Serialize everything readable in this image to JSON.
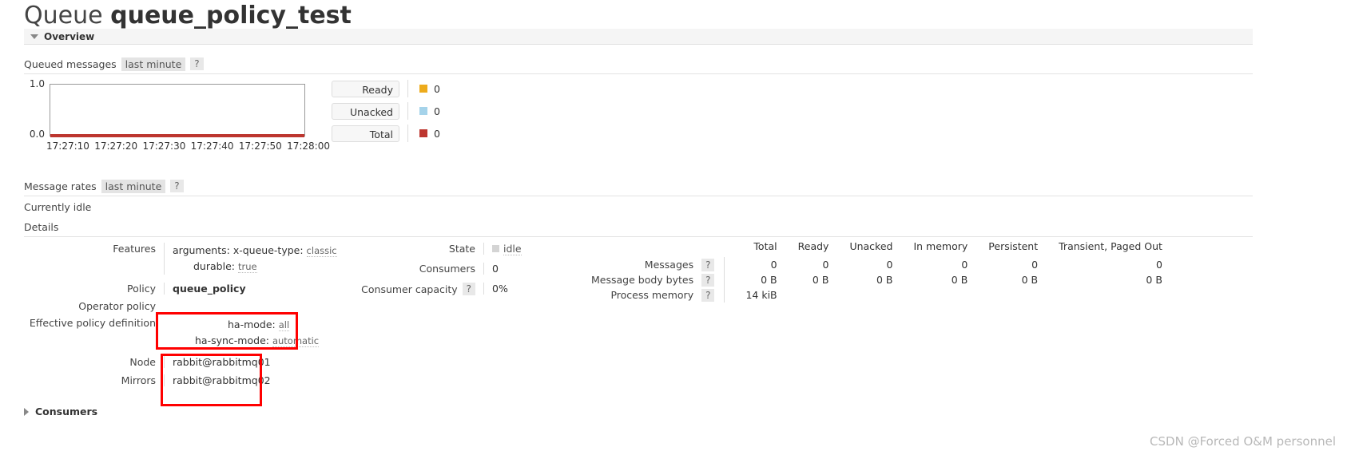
{
  "header": {
    "title_prefix": "Queue",
    "queue_name": "queue_policy_test",
    "overview_label": "Overview"
  },
  "queued_messages": {
    "label": "Queued messages",
    "period": "last minute",
    "help": "?"
  },
  "chart_data": {
    "type": "line",
    "title": "Queued messages last minute",
    "xlabel": "",
    "ylabel": "",
    "ylim": [
      0.0,
      1.0
    ],
    "ytick_labels": [
      "1.0",
      "0.0"
    ],
    "x": [
      "17:27:10",
      "17:27:20",
      "17:27:30",
      "17:27:40",
      "17:27:50",
      "17:28:00"
    ],
    "grid": false,
    "legend_position": "right",
    "series": [
      {
        "name": "Ready",
        "color": "#edab1c",
        "value": "0",
        "values": [
          0,
          0,
          0,
          0,
          0,
          0
        ]
      },
      {
        "name": "Unacked",
        "color": "#a5d3ea",
        "value": "0",
        "values": [
          0,
          0,
          0,
          0,
          0,
          0
        ]
      },
      {
        "name": "Total",
        "color": "#bd362f",
        "value": "0",
        "values": [
          0,
          0,
          0,
          0,
          0,
          0
        ]
      }
    ]
  },
  "message_rates": {
    "label": "Message rates",
    "period": "last minute",
    "help": "?",
    "status": "Currently idle"
  },
  "details": {
    "label": "Details",
    "features": {
      "label": "Features",
      "rows": [
        {
          "key": "arguments:",
          "sub_key": "x-queue-type:",
          "value": "classic"
        },
        {
          "key": "durable:",
          "sub_key": "",
          "value": "true"
        }
      ]
    },
    "policy": {
      "label": "Policy",
      "value": "queue_policy"
    },
    "operator_policy": {
      "label": "Operator policy",
      "value": ""
    },
    "effective_policy_definition": {
      "label": "Effective policy definition",
      "rows": [
        {
          "key": "ha-mode:",
          "value": "all"
        },
        {
          "key": "ha-sync-mode:",
          "value": "automatic"
        }
      ]
    },
    "node": {
      "label": "Node",
      "value": "rabbit@rabbitmq01"
    },
    "mirrors": {
      "label": "Mirrors",
      "value": "rabbit@rabbitmq02"
    },
    "state": {
      "label": "State",
      "value": "idle"
    },
    "consumers": {
      "label": "Consumers",
      "value": "0"
    },
    "consumer_capacity": {
      "label": "Consumer capacity",
      "help": "?",
      "value": "0%"
    }
  },
  "stats": {
    "columns": [
      "Total",
      "Ready",
      "Unacked",
      "In memory",
      "Persistent",
      "Transient, Paged Out"
    ],
    "rows": [
      {
        "label": "Messages",
        "help": "?",
        "values": [
          "0",
          "0",
          "0",
          "0",
          "0",
          "0"
        ]
      },
      {
        "label": "Message body bytes",
        "help": "?",
        "values": [
          "0 B",
          "0 B",
          "0 B",
          "0 B",
          "0 B",
          "0 B"
        ]
      },
      {
        "label": "Process memory",
        "help": "?",
        "values": [
          "14 kiB",
          "",
          "",
          "",
          "",
          ""
        ]
      }
    ]
  },
  "footer": {
    "consumers_section": "Consumers",
    "watermark": "CSDN @Forced O&M personnel"
  }
}
